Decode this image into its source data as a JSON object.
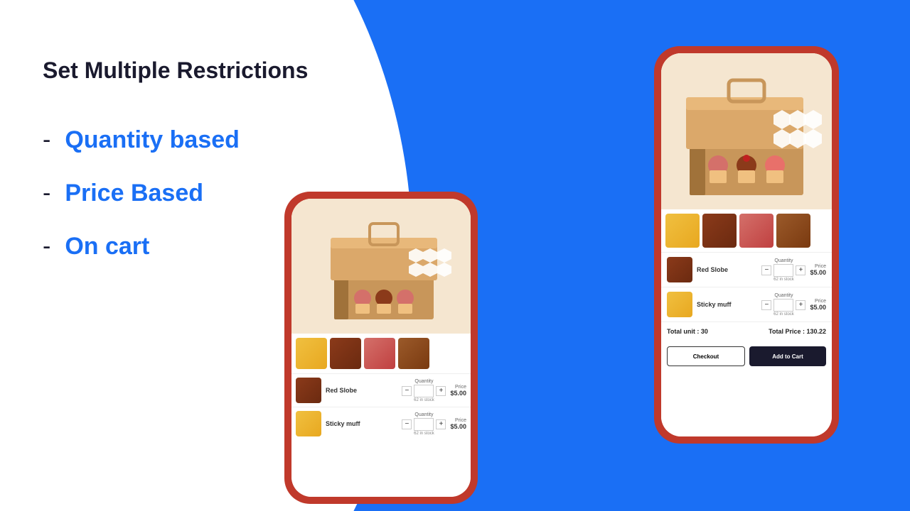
{
  "page": {
    "background_color": "#1a6ff5"
  },
  "left_section": {
    "title": "Set Multiple Restrictions",
    "items": [
      {
        "dash": "-",
        "label": "Quantity based"
      },
      {
        "dash": "-",
        "label": "Price Based"
      },
      {
        "dash": "-",
        "label": "On cart"
      }
    ]
  },
  "phone_left": {
    "product_image_alt": "Cupcake box",
    "thumbnails": [
      "Yellow cupcake",
      "Chocolate cupcake",
      "Red velvet cupcake",
      "Cupcake 4"
    ],
    "products": [
      {
        "name": "Red Slobe",
        "quantity_label": "Quantity",
        "qty": "",
        "stock": "62 in stock",
        "price_label": "Price",
        "price": "$5.00"
      },
      {
        "name": "Sticky muff",
        "quantity_label": "Quantity",
        "qty": "",
        "stock": "62 in stock",
        "price_label": "Price",
        "price": "$5.00"
      }
    ]
  },
  "phone_right": {
    "product_image_alt": "Cupcake box large",
    "thumbnails": [
      "Yellow cupcake",
      "Chocolate cupcake",
      "Red velvet cupcake",
      "Cupcake 4"
    ],
    "products": [
      {
        "name": "Red Slobe",
        "quantity_label": "Quantity",
        "qty": "",
        "stock": "62 in stock",
        "price_label": "Price",
        "price": "$5.00"
      },
      {
        "name": "Sticky muff",
        "quantity_label": "Quantity",
        "qty": "",
        "stock": "62 in stock",
        "price_label": "Price",
        "price": "$5.00"
      }
    ],
    "total_unit_label": "Total unit : 30",
    "total_price_label": "Total Price : 130.22",
    "checkout_btn": "Checkout",
    "addcart_btn": "Add to Cart"
  }
}
